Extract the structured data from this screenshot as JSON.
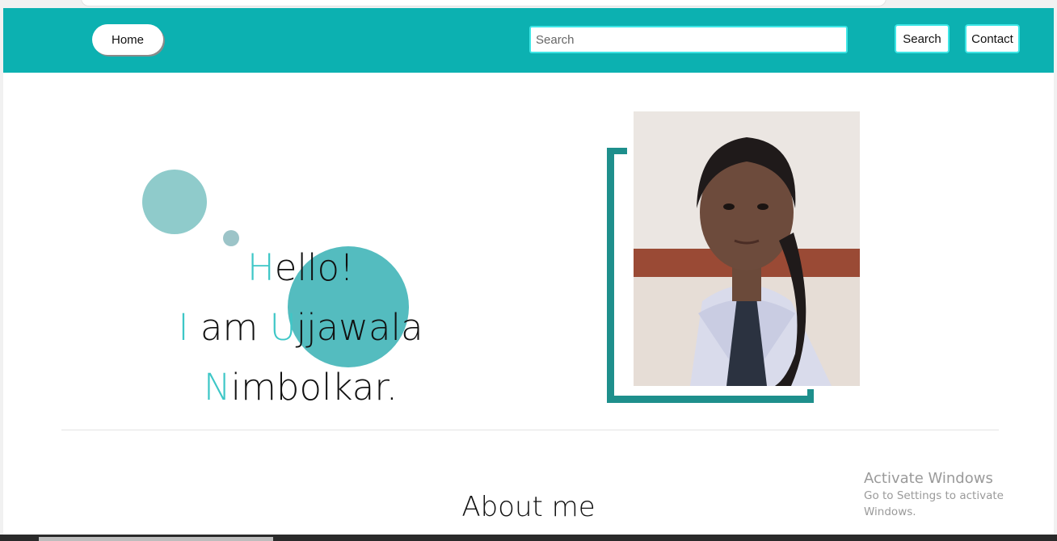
{
  "navbar": {
    "home_label": "Home",
    "search_placeholder": "Search",
    "search_button": "Search",
    "contact_button": "Contact"
  },
  "hero": {
    "line1_initial": "H",
    "line1_rest": "ello!",
    "line2_i": "I",
    "line2_am": " am ",
    "line2_initial": "U",
    "line2_rest": "jjawala",
    "line3_initial": "N",
    "line3_rest": "imbolkar."
  },
  "about": {
    "title": "About me"
  },
  "watermark": {
    "title": "Activate Windows",
    "subtitle": "Go to Settings to activate Windows."
  },
  "colors": {
    "navbar": "#0cb1b1",
    "accent": "#3ec7c7",
    "frame": "#1e8f8c"
  }
}
